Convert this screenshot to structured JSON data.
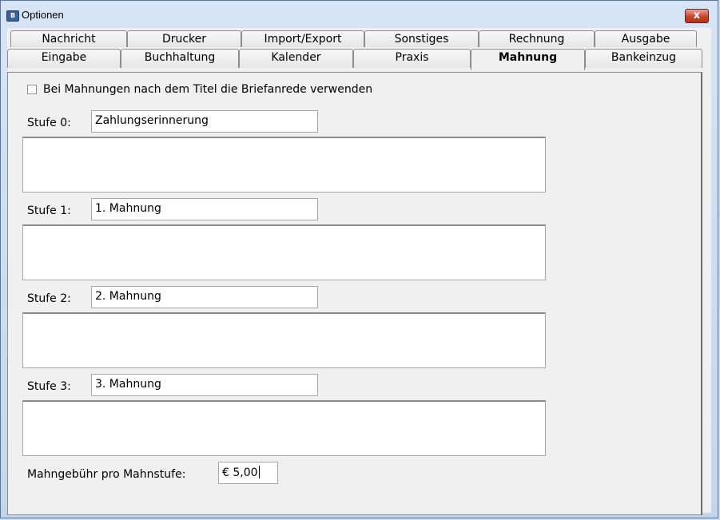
{
  "window": {
    "title": "Optionen",
    "close_label": "x"
  },
  "tabs": {
    "row1": [
      "Nachricht",
      "Drucker",
      "Import/Export",
      "Sonstiges",
      "Rechnung",
      "Ausgabe"
    ],
    "row2": [
      "Eingabe",
      "Buchhaltung",
      "Kalender",
      "Praxis",
      "Mahnung",
      "Bankeinzug"
    ],
    "active": "Mahnung"
  },
  "mahnung": {
    "checkbox_label": "Bei Mahnungen nach dem Titel die Briefanrede verwenden",
    "checkbox_checked": false,
    "stufen": [
      {
        "label": "Stufe 0:",
        "title": "Zahlungserinnerung",
        "text": ""
      },
      {
        "label": "Stufe 1:",
        "title": "1. Mahnung",
        "text": ""
      },
      {
        "label": "Stufe 2:",
        "title": "2. Mahnung",
        "text": ""
      },
      {
        "label": "Stufe 3:",
        "title": "3. Mahnung",
        "text": ""
      }
    ],
    "fee_label": "Mahngebühr pro Mahnstufe:",
    "fee_value": "€ 5,00"
  },
  "colors": {
    "title_bar": "#c9d9ee",
    "panel": "#f0f0f0",
    "close_button": "#c7442d"
  }
}
